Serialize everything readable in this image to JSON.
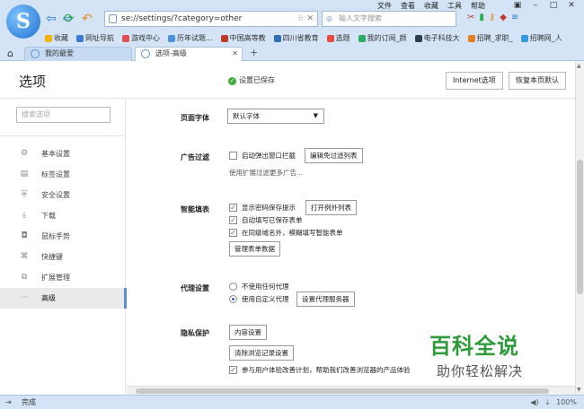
{
  "browser": {
    "logo_letter": "S",
    "menu": [
      "文件",
      "查看",
      "收藏",
      "工具",
      "帮助"
    ],
    "address": "se://settings/?category=other",
    "search_placeholder": "输入文字搜索",
    "bookmarks": [
      {
        "label": "收藏",
        "color": "#f0b400"
      },
      {
        "label": "网址导航",
        "color": "#3a7bd5"
      },
      {
        "label": "游戏中心",
        "color": "#e05050"
      },
      {
        "label": "历年试题...",
        "color": "#4a90e2"
      },
      {
        "label": "中国高等教",
        "color": "#c0392b"
      },
      {
        "label": "四川省教育",
        "color": "#2f6db5"
      },
      {
        "label": "选题",
        "color": "#e74c3c"
      },
      {
        "label": "我的订阅_颜",
        "color": "#27ae60"
      },
      {
        "label": "电子科技大",
        "color": "#2c3e50"
      },
      {
        "label": "招聘_求职_",
        "color": "#e67e22"
      },
      {
        "label": "招聘网_人",
        "color": "#3498db"
      }
    ],
    "tabs": [
      {
        "label": "我的最爱"
      },
      {
        "label": "选项-高级"
      }
    ],
    "status_text": "完成",
    "zoom": "100%"
  },
  "settings": {
    "title": "选项",
    "saved_text": "设置已保存",
    "internet_options": "Internet选项",
    "restore_page": "恢复本页默认",
    "search_placeholder": "搜索选项",
    "nav": [
      {
        "label": "基本设置",
        "icon": "gear-icon"
      },
      {
        "label": "标签设置",
        "icon": "tabs-icon"
      },
      {
        "label": "安全设置",
        "icon": "shield-icon"
      },
      {
        "label": "下载",
        "icon": "download-icon"
      },
      {
        "label": "鼠标手势",
        "icon": "mouse-icon"
      },
      {
        "label": "快捷键",
        "icon": "shortcut-icon"
      },
      {
        "label": "扩展管理",
        "icon": "extension-icon"
      },
      {
        "label": "高级",
        "icon": "more-icon"
      }
    ],
    "font": {
      "label": "页面字体",
      "value": "默认字体"
    },
    "adblock": {
      "label": "广告过滤",
      "popup_block": "启动弹出窗口拦截",
      "edit_whitelist": "编辑免过滤列表",
      "more_note": "使用扩展过滤更多广告..."
    },
    "autofill": {
      "label": "智能填表",
      "show_prompt": "显示密码保存提示",
      "open_exceptions": "打开例外列表",
      "auto_fill": "自动填写已保存表单",
      "fuzzy_fill": "在同级域名外，模糊填写智能表单",
      "manage_data": "管理表单数据"
    },
    "proxy": {
      "label": "代理设置",
      "no_proxy": "不使用任何代理",
      "custom_proxy": "使用自定义代理",
      "set_server": "设置代理服务器"
    },
    "privacy": {
      "label": "隐私保护",
      "content_settings": "内容设置",
      "clear_history": "清除浏览记录设置",
      "ux_program": "参与用户体验改善计划，帮助我们改善浏览器的产品体验"
    }
  },
  "watermark": {
    "title": "百科全说",
    "subtitle": "助你轻松解决"
  }
}
